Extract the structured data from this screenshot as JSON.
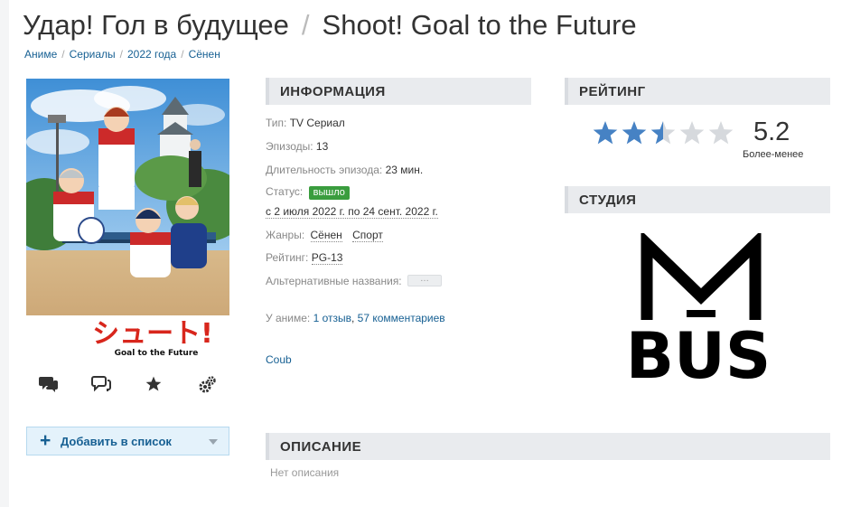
{
  "title": {
    "ru": "Удар! Гол в будущее",
    "separator": "/",
    "en": "Shoot! Goal to the Future"
  },
  "breadcrumb": [
    {
      "label": "Аниме"
    },
    {
      "label": "Сериалы"
    },
    {
      "label": "2022 года"
    },
    {
      "label": "Сёнен"
    }
  ],
  "breadcrumb_separator": "/",
  "poster": {
    "logo_text": "シュート!",
    "logo_sub": "Goal to the Future"
  },
  "poster_actions": [
    "comments-icon",
    "reviews-icon",
    "favorite-star-icon",
    "settings-gears-icon"
  ],
  "add_to_list": {
    "plus": "+",
    "label": "Добавить в список"
  },
  "info": {
    "heading": "ИНФОРМАЦИЯ",
    "type_key": "Тип:",
    "type_value": "TV Сериал",
    "episodes_key": "Эпизоды:",
    "episodes_value": "13",
    "duration_key": "Длительность эпизода:",
    "duration_value": "23 мин.",
    "status_key": "Статус:",
    "status_badge": "вышло",
    "status_color": "#3a9d3e",
    "aired": "с 2 июля 2022 г. по 24 сент. 2022 г.",
    "genres_key": "Жанры:",
    "genres": [
      "Сёнен",
      "Спорт"
    ],
    "rating_key": "Рейтинг:",
    "rating_value": "PG-13",
    "alt_names_key": "Альтернативные названия:",
    "alt_names_more": "…",
    "about_key": "У аниме:",
    "about_reviews": "1 отзыв",
    "about_sep": ",",
    "about_comments": "57 комментариев",
    "coub": "Coub"
  },
  "rating": {
    "heading": "РЕЙТИНГ",
    "score": "5.2",
    "stars_filled": 2.5,
    "stars_total": 5,
    "star_color": "#4682c4",
    "star_empty_color": "#d6d9dd",
    "label": "Более-менее"
  },
  "studio": {
    "heading": "СТУДИЯ",
    "logo_top": "M",
    "logo_bottom": "BUS"
  },
  "description": {
    "heading": "ОПИСАНИЕ",
    "empty": "Нет описания"
  },
  "colors": {
    "link": "#176093",
    "section_bg": "#e9ebee",
    "add_list_bg": "#e4f2fb"
  }
}
